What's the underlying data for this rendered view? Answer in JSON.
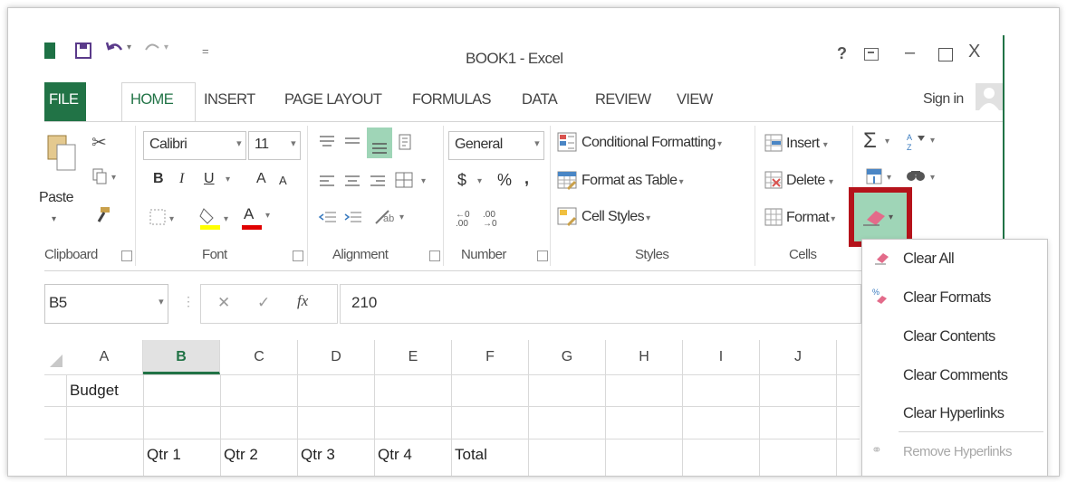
{
  "window": {
    "title": "BOOK1 - Excel",
    "help": "?",
    "restore_icon": "ribbon-display-icon",
    "minimize": "–",
    "maximize": "☐",
    "close": "X"
  },
  "qat": {
    "save": "save-icon",
    "undo": "undo-icon",
    "redo": "redo-icon",
    "customize": "="
  },
  "tabs": [
    {
      "label": "FILE"
    },
    {
      "label": "HOME"
    },
    {
      "label": "INSERT"
    },
    {
      "label": "PAGE LAYOUT"
    },
    {
      "label": "FORMULAS"
    },
    {
      "label": "DATA"
    },
    {
      "label": "REVIEW"
    },
    {
      "label": "VIEW"
    }
  ],
  "sign_in": "Sign in",
  "clipboard": {
    "paste": "Paste",
    "group": "Clipboard"
  },
  "font": {
    "name": "Calibri",
    "size": "11",
    "bold": "B",
    "italic": "I",
    "underline": "U",
    "grow": "A",
    "shrink": "A",
    "color_letter": "A",
    "group": "Font"
  },
  "alignment": {
    "group": "Alignment"
  },
  "number": {
    "format": "General",
    "currency": "$",
    "percent": "%",
    "comma": ",",
    "inc": "←0 .00",
    "dec": ".00 →0",
    "group": "Number"
  },
  "styles": {
    "conditional": "Conditional Formatting",
    "format_table": "Format as Table",
    "cell_styles": "Cell Styles",
    "group": "Styles"
  },
  "cells": {
    "insert": "Insert",
    "delete": "Delete",
    "format": "Format",
    "group": "Cells"
  },
  "editing": {
    "sum": "Σ",
    "sort": "sort-filter-icon",
    "find": "find-icon",
    "fill": "fill-icon",
    "clear": "clear-icon"
  },
  "formula_bar": {
    "name_box": "B5",
    "cancel": "✕",
    "enter": "✓",
    "fx": "fx",
    "value": "210"
  },
  "columns": [
    "A",
    "B",
    "C",
    "D",
    "E",
    "F",
    "G",
    "H",
    "I",
    "J"
  ],
  "cells_data": {
    "a1": "Budget",
    "b3": "Qtr 1",
    "c3": "Qtr 2",
    "d3": "Qtr 3",
    "e3": "Qtr 4",
    "f3": "Total"
  },
  "clear_menu": [
    {
      "label": "Clear All",
      "icon": "eraser-icon",
      "enabled": true
    },
    {
      "label": "Clear Formats",
      "icon": "clear-formats-icon",
      "enabled": true
    },
    {
      "label": "Clear Contents",
      "icon": "",
      "enabled": true
    },
    {
      "label": "Clear Comments",
      "icon": "",
      "enabled": true
    },
    {
      "label": "Clear Hyperlinks",
      "icon": "",
      "enabled": true
    },
    {
      "label": "Remove Hyperlinks",
      "icon": "remove-link-icon",
      "enabled": false
    }
  ],
  "colors": {
    "accent": "#217346",
    "highlight": "#b5131b",
    "selected_btn": "#9fd5b7"
  }
}
